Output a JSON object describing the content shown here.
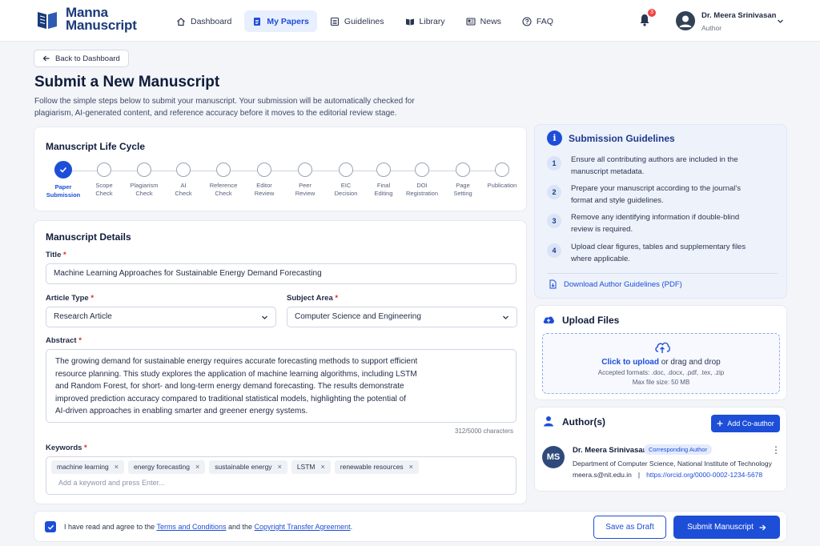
{
  "brand": {
    "line1": "Manna",
    "line2": "Manuscript"
  },
  "nav": {
    "items": [
      {
        "label": "Dashboard",
        "icon": "home-icon"
      },
      {
        "label": "My Papers",
        "icon": "document-icon",
        "active": true
      },
      {
        "label": "Guidelines",
        "icon": "list-icon"
      },
      {
        "label": "Library",
        "icon": "book-icon"
      },
      {
        "label": "News",
        "icon": "newspaper-icon"
      },
      {
        "label": "FAQ",
        "icon": "help-circle-icon"
      }
    ],
    "notification_count": "3"
  },
  "user": {
    "name": "Dr. Meera Srinivasan",
    "role": "Author"
  },
  "back_label": "Back to Dashboard",
  "page": {
    "title": "Submit a New Manuscript",
    "intro": "Follow the simple steps below to submit your manuscript. Your submission will be automatically checked for plagiarism, AI-generated content, and reference accuracy before it moves to the editorial review stage."
  },
  "lifecycle": {
    "title": "Manuscript Life Cycle",
    "steps": [
      {
        "line1": "Paper",
        "line2": "Submission",
        "done": true
      },
      {
        "line1": "Scope",
        "line2": "Check"
      },
      {
        "line1": "Plagiarism",
        "line2": "Check"
      },
      {
        "line1": "AI",
        "line2": "Check"
      },
      {
        "line1": "Reference",
        "line2": "Check"
      },
      {
        "line1": "Editor",
        "line2": "Review"
      },
      {
        "line1": "Peer",
        "line2": "Review"
      },
      {
        "line1": "EIC",
        "line2": "Decision"
      },
      {
        "line1": "Final",
        "line2": "Editing"
      },
      {
        "line1": "DOI",
        "line2": "Registration"
      },
      {
        "line1": "Page",
        "line2": "Setting"
      },
      {
        "line1": "Publication",
        "line2": ""
      }
    ]
  },
  "details": {
    "title": "Manuscript Details",
    "title_label": "Title",
    "title_value": "Machine Learning Approaches for Sustainable Energy Demand Forecasting",
    "article_type_label": "Article Type",
    "article_type_value": "Research Article",
    "subject_label": "Subject Area",
    "subject_value": "Computer Science and Engineering",
    "abstract_label": "Abstract",
    "abstract_lines": [
      "The growing demand for sustainable energy requires accurate forecasting methods to support efficient",
      "resource planning. This study explores the application of machine learning algorithms, including LSTM",
      "and Random Forest, for short- and long-term energy demand forecasting. The results demonstrate",
      "improved prediction accuracy compared to traditional statistical models, highlighting the potential of",
      "AI-driven approaches in enabling smarter and greener energy systems."
    ],
    "abstract_counter": "312/5000 characters",
    "keywords_label": "Keywords",
    "keywords": [
      "machine learning",
      "energy forecasting",
      "sustainable energy",
      "LSTM",
      "renewable resources"
    ],
    "keywords_placeholder": "Add a keyword and press Enter..."
  },
  "guidelines": {
    "title": "Submission Guidelines",
    "items": [
      {
        "num": "1",
        "line1": "Ensure all contributing authors are included in the",
        "line2": "manuscript metadata."
      },
      {
        "num": "2",
        "line1": "Prepare your manuscript according to the journal's",
        "line2": "format and style guidelines."
      },
      {
        "num": "3",
        "line1": "Remove any identifying information if double-blind",
        "line2": "review is required."
      },
      {
        "num": "4",
        "line1": "Upload clear figures, tables and supplementary files",
        "line2": "where applicable."
      }
    ],
    "download_label": "Download Author Guidelines (PDF)"
  },
  "upload": {
    "title": "Upload Files",
    "link": "Click to upload",
    "rest": " or drag and drop",
    "formats": "Accepted formats: .doc, .docx, .pdf, .tex, .zip",
    "max_size": "Max file size: 50 MB"
  },
  "authors": {
    "title": "Author(s)",
    "add_label": "Add Co-author",
    "list": [
      {
        "initials": "MS",
        "name": "Dr. Meera Srinivasan",
        "badge": "Corresponding Author",
        "dept": "Department of Computer Science, National Institute of Technology",
        "email": "meera.s@nit.edu.in",
        "sep": "|",
        "orcid": "https://orcid.org/0000-0002-1234-5678"
      }
    ]
  },
  "footer": {
    "agree_prefix": "I have read and agree to the ",
    "terms": "Terms and Conditions",
    "and": " and the ",
    "copyright": "Copyright Transfer Agreement",
    "suffix": ".",
    "draft_label": "Save as Draft",
    "submit_label": "Submit Manuscript"
  },
  "colors": {
    "primary": "#1d4ed8",
    "brand": "#1a3a7a",
    "required": "#dc2626"
  }
}
